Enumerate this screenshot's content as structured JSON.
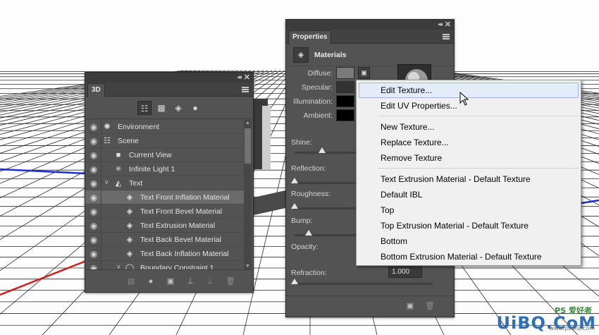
{
  "panel_3d": {
    "tab": "3D",
    "tools": [
      "scene-filter-icon",
      "mesh-filter-icon",
      "material-filter-icon",
      "light-filter-icon"
    ],
    "layers": [
      {
        "label": "Environment",
        "icon": "environment-icon"
      },
      {
        "label": "Scene",
        "icon": "scene-icon"
      },
      {
        "label": "Current View",
        "icon": "camera-icon"
      },
      {
        "label": "Infinite Light 1",
        "icon": "light-icon"
      },
      {
        "label": "Text",
        "icon": "mesh-icon"
      },
      {
        "label": "Text Front Inflation Material",
        "icon": "material-icon",
        "selected": true
      },
      {
        "label": "Text Front Bevel Material",
        "icon": "material-icon"
      },
      {
        "label": "Text Extrusion Material",
        "icon": "material-icon"
      },
      {
        "label": "Text Back Bevel Material",
        "icon": "material-icon"
      },
      {
        "label": "Text Back Inflation Material",
        "icon": "material-icon"
      },
      {
        "label": "Boundary Constraint 1",
        "icon": "constraint-icon"
      }
    ]
  },
  "properties": {
    "tab": "Properties",
    "section": "Materials",
    "diffuse_label": "Diffuse:",
    "specular_label": "Specular:",
    "illumination_label": "Illumination:",
    "ambient_label": "Ambient:",
    "shine_label": "Shine:",
    "reflection_label": "Reflection:",
    "roughness_label": "Roughness:",
    "bump_label": "Bump:",
    "opacity_label": "Opacity:",
    "refraction_label": "Refraction:",
    "refraction_value": "1.000",
    "shine_level": 0.2,
    "reflection_level": 0.0,
    "roughness_level": 0.0,
    "bump_level": 0.1,
    "refraction_level": 0.0,
    "colors": {
      "diffuse": "#7a7a7a",
      "specular": "#333333",
      "illumination": "#000000",
      "ambient": "#000000"
    }
  },
  "context_menu": {
    "items": [
      {
        "label": "Edit Texture...",
        "highlighted": true
      },
      {
        "label": "Edit UV Properties..."
      },
      {
        "label": "New Texture..."
      },
      {
        "label": "Replace Texture..."
      },
      {
        "label": "Remove Texture"
      },
      {
        "label": "Text Extrusion Material - Default Texture"
      },
      {
        "label": "Default IBL"
      },
      {
        "label": "Top"
      },
      {
        "label": "Top Extrusion Material - Default Texture"
      },
      {
        "label": "Bottom"
      },
      {
        "label": "Bottom Extrusion Material - Default Texture"
      }
    ]
  },
  "watermark": {
    "brand": "UiBQ.CoM",
    "ps": "PS 爱好者",
    "url": "www.psahz.com"
  }
}
